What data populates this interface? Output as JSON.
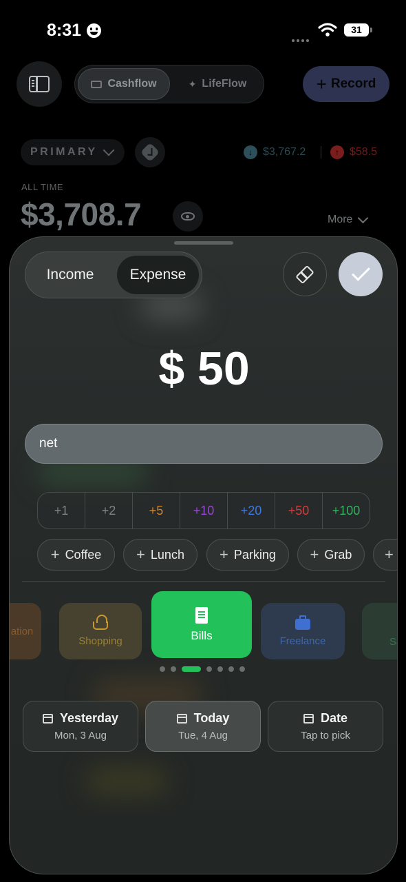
{
  "status_bar": {
    "time": "8:31",
    "battery": "31"
  },
  "topbar": {
    "segments": [
      {
        "label": "Cashflow",
        "active": true
      },
      {
        "label": "LifeFlow",
        "active": false
      }
    ],
    "record_label": "Record"
  },
  "account": {
    "name": "PRIMARY",
    "income_total": "$3,767.2",
    "expense_total": "$58.5",
    "period_label": "ALL TIME",
    "balance": "$3,708.7",
    "more_label": "More"
  },
  "sheet": {
    "type_toggle": {
      "income": "Income",
      "expense": "Expense",
      "selected": "Expense"
    },
    "amount": "$ 50",
    "note_value": "net",
    "quick_amounts": [
      {
        "label": "+1",
        "color": "#7e8482"
      },
      {
        "label": "+2",
        "color": "#7e8482"
      },
      {
        "label": "+5",
        "color": "#d0822b"
      },
      {
        "label": "+10",
        "color": "#9a45d8"
      },
      {
        "label": "+20",
        "color": "#3d78e0"
      },
      {
        "label": "+50",
        "color": "#d8393b"
      },
      {
        "label": "+100",
        "color": "#2fb35a"
      }
    ],
    "quick_notes": [
      "Coffee",
      "Lunch",
      "Parking",
      "Grab",
      ""
    ],
    "categories": [
      {
        "label": "ation",
        "icon": "education-icon"
      },
      {
        "label": "Shopping",
        "icon": "basket-icon"
      },
      {
        "label": "Bills",
        "icon": "receipt-icon",
        "selected": true
      },
      {
        "label": "Freelance",
        "icon": "briefcase-icon"
      },
      {
        "label": "Sa",
        "icon": "savings-icon"
      }
    ],
    "pager": {
      "count": 7,
      "active_index": 2
    },
    "dates": [
      {
        "title": "Yesterday",
        "sub": "Mon, 3 Aug"
      },
      {
        "title": "Today",
        "sub": "Tue, 4 Aug",
        "selected": true
      },
      {
        "title": "Date",
        "sub": "Tap to pick"
      }
    ]
  },
  "colors": {
    "accent_green": "#22c15a",
    "record_bg": "#2d3351",
    "expense_red": "#d8393b"
  }
}
